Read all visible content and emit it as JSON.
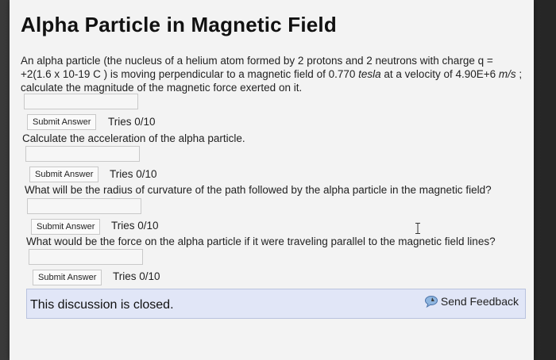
{
  "title": "Alpha Particle in Magnetic Field",
  "intro": {
    "part1": "An alpha particle (the nucleus of a helium atom formed by 2 protons and 2 neutrons with charge q = +2(1.6 x 10-19 C ) is moving perpendicular to a magnetic field of 0.770 ",
    "field_unit": "tesla",
    "part2": " at a velocity of 4.90E+6 ",
    "velocity_unit": "m/s",
    "part3": " ; calculate the magnitude of the magnetic force exerted on it."
  },
  "submit_label": "Submit Answer",
  "questions": [
    {
      "tries": "Tries 0/10",
      "next_question": "Calculate the acceleration of the alpha particle."
    },
    {
      "tries": "Tries 0/10",
      "next_question": "What will be the radius of curvature of the path followed by the alpha particle in the magnetic field?"
    },
    {
      "tries": "Tries 0/10",
      "next_question": "What would be the force on the alpha particle if it were traveling parallel to the magnetic field lines?"
    },
    {
      "tries": "Tries 0/10"
    }
  ],
  "closed_text": "This discussion is closed.",
  "send_feedback_label": "Send Feedback",
  "icons": {
    "feedback": "speech-bubble-icon",
    "cursor": "text-cursor-icon"
  },
  "colors": {
    "closed_bar": "#e1e6f7",
    "page_bg": "#f3f3f3"
  }
}
